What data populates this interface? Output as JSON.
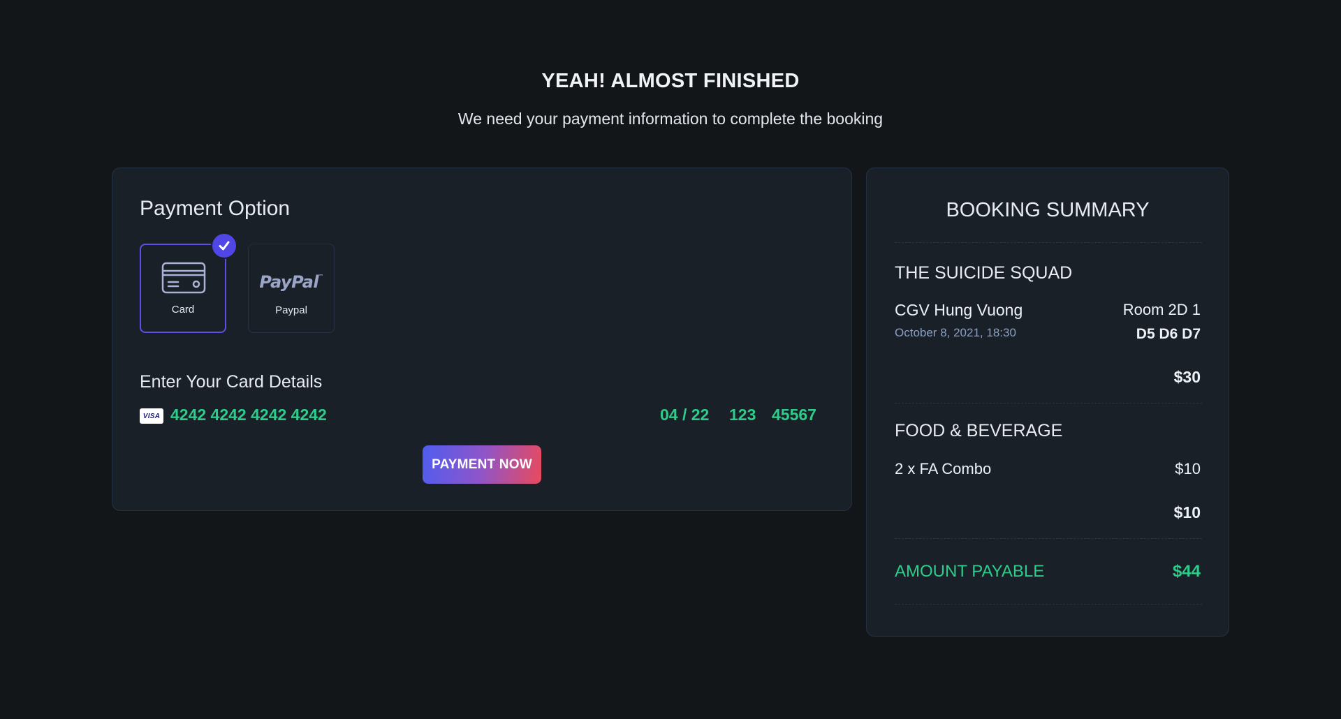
{
  "header": {
    "title": "YEAH! ALMOST FINISHED",
    "subtitle": "We need your payment information to complete the booking"
  },
  "payment": {
    "title": "Payment Option",
    "options": [
      {
        "label": "Card",
        "icon": "credit-card-icon",
        "selected": true
      },
      {
        "label": "Paypal",
        "icon": "paypal-logo",
        "selected": false
      }
    ],
    "paypal_logo_text": "PayPal",
    "details_title": "Enter Your Card Details",
    "card_brand": "VISA",
    "card_number": "4242 4242 4242 4242",
    "expiry": "04 / 22",
    "cvc": "123",
    "zip": "45567",
    "submit_label": "PAYMENT NOW"
  },
  "summary": {
    "title": "BOOKING SUMMARY",
    "movie": "THE SUICIDE SQUAD",
    "cinema": "CGV Hung Vuong",
    "showtime": "October 8, 2021, 18:30",
    "room": "Room 2D 1",
    "seats": "D5 D6 D7",
    "ticket_total": "$30",
    "fb_title": "FOOD & BEVERAGE",
    "fb_items": [
      {
        "name": "2 x FA Combo",
        "price": "$10"
      }
    ],
    "fb_total": "$10",
    "amount_label": "AMOUNT PAYABLE",
    "amount_value": "$44"
  },
  "colors": {
    "background": "#131619",
    "panel": "#1a2028",
    "accent": "#4f46e5",
    "highlight": "#2ecc8a"
  }
}
